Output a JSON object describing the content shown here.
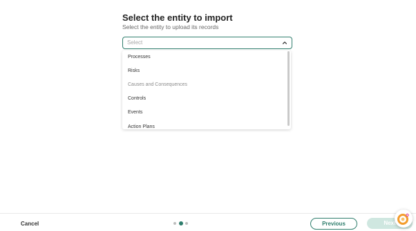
{
  "header": {
    "title": "Select the entity to import",
    "subtitle": "Select the entity to upload its records"
  },
  "select": {
    "placeholder": "Select",
    "icon": "chevron-up-icon"
  },
  "dropdown": {
    "options": [
      {
        "label": "Processes",
        "disabled": false
      },
      {
        "label": "Risks",
        "disabled": false
      },
      {
        "label": "Causes and Consequences",
        "disabled": true
      },
      {
        "label": "Controls",
        "disabled": false
      },
      {
        "label": "Events",
        "disabled": false
      },
      {
        "label": "Action Plans",
        "disabled": false
      }
    ]
  },
  "footer": {
    "cancel_label": "Cancel",
    "steps": {
      "total": 3,
      "current": 2
    },
    "previous_label": "Previous",
    "next_label": "Next"
  },
  "colors": {
    "accent": "#2e7d6c",
    "next_disabled_bg": "#cfe7e0"
  },
  "assistant": {
    "icon": "chat-assistant-icon"
  }
}
